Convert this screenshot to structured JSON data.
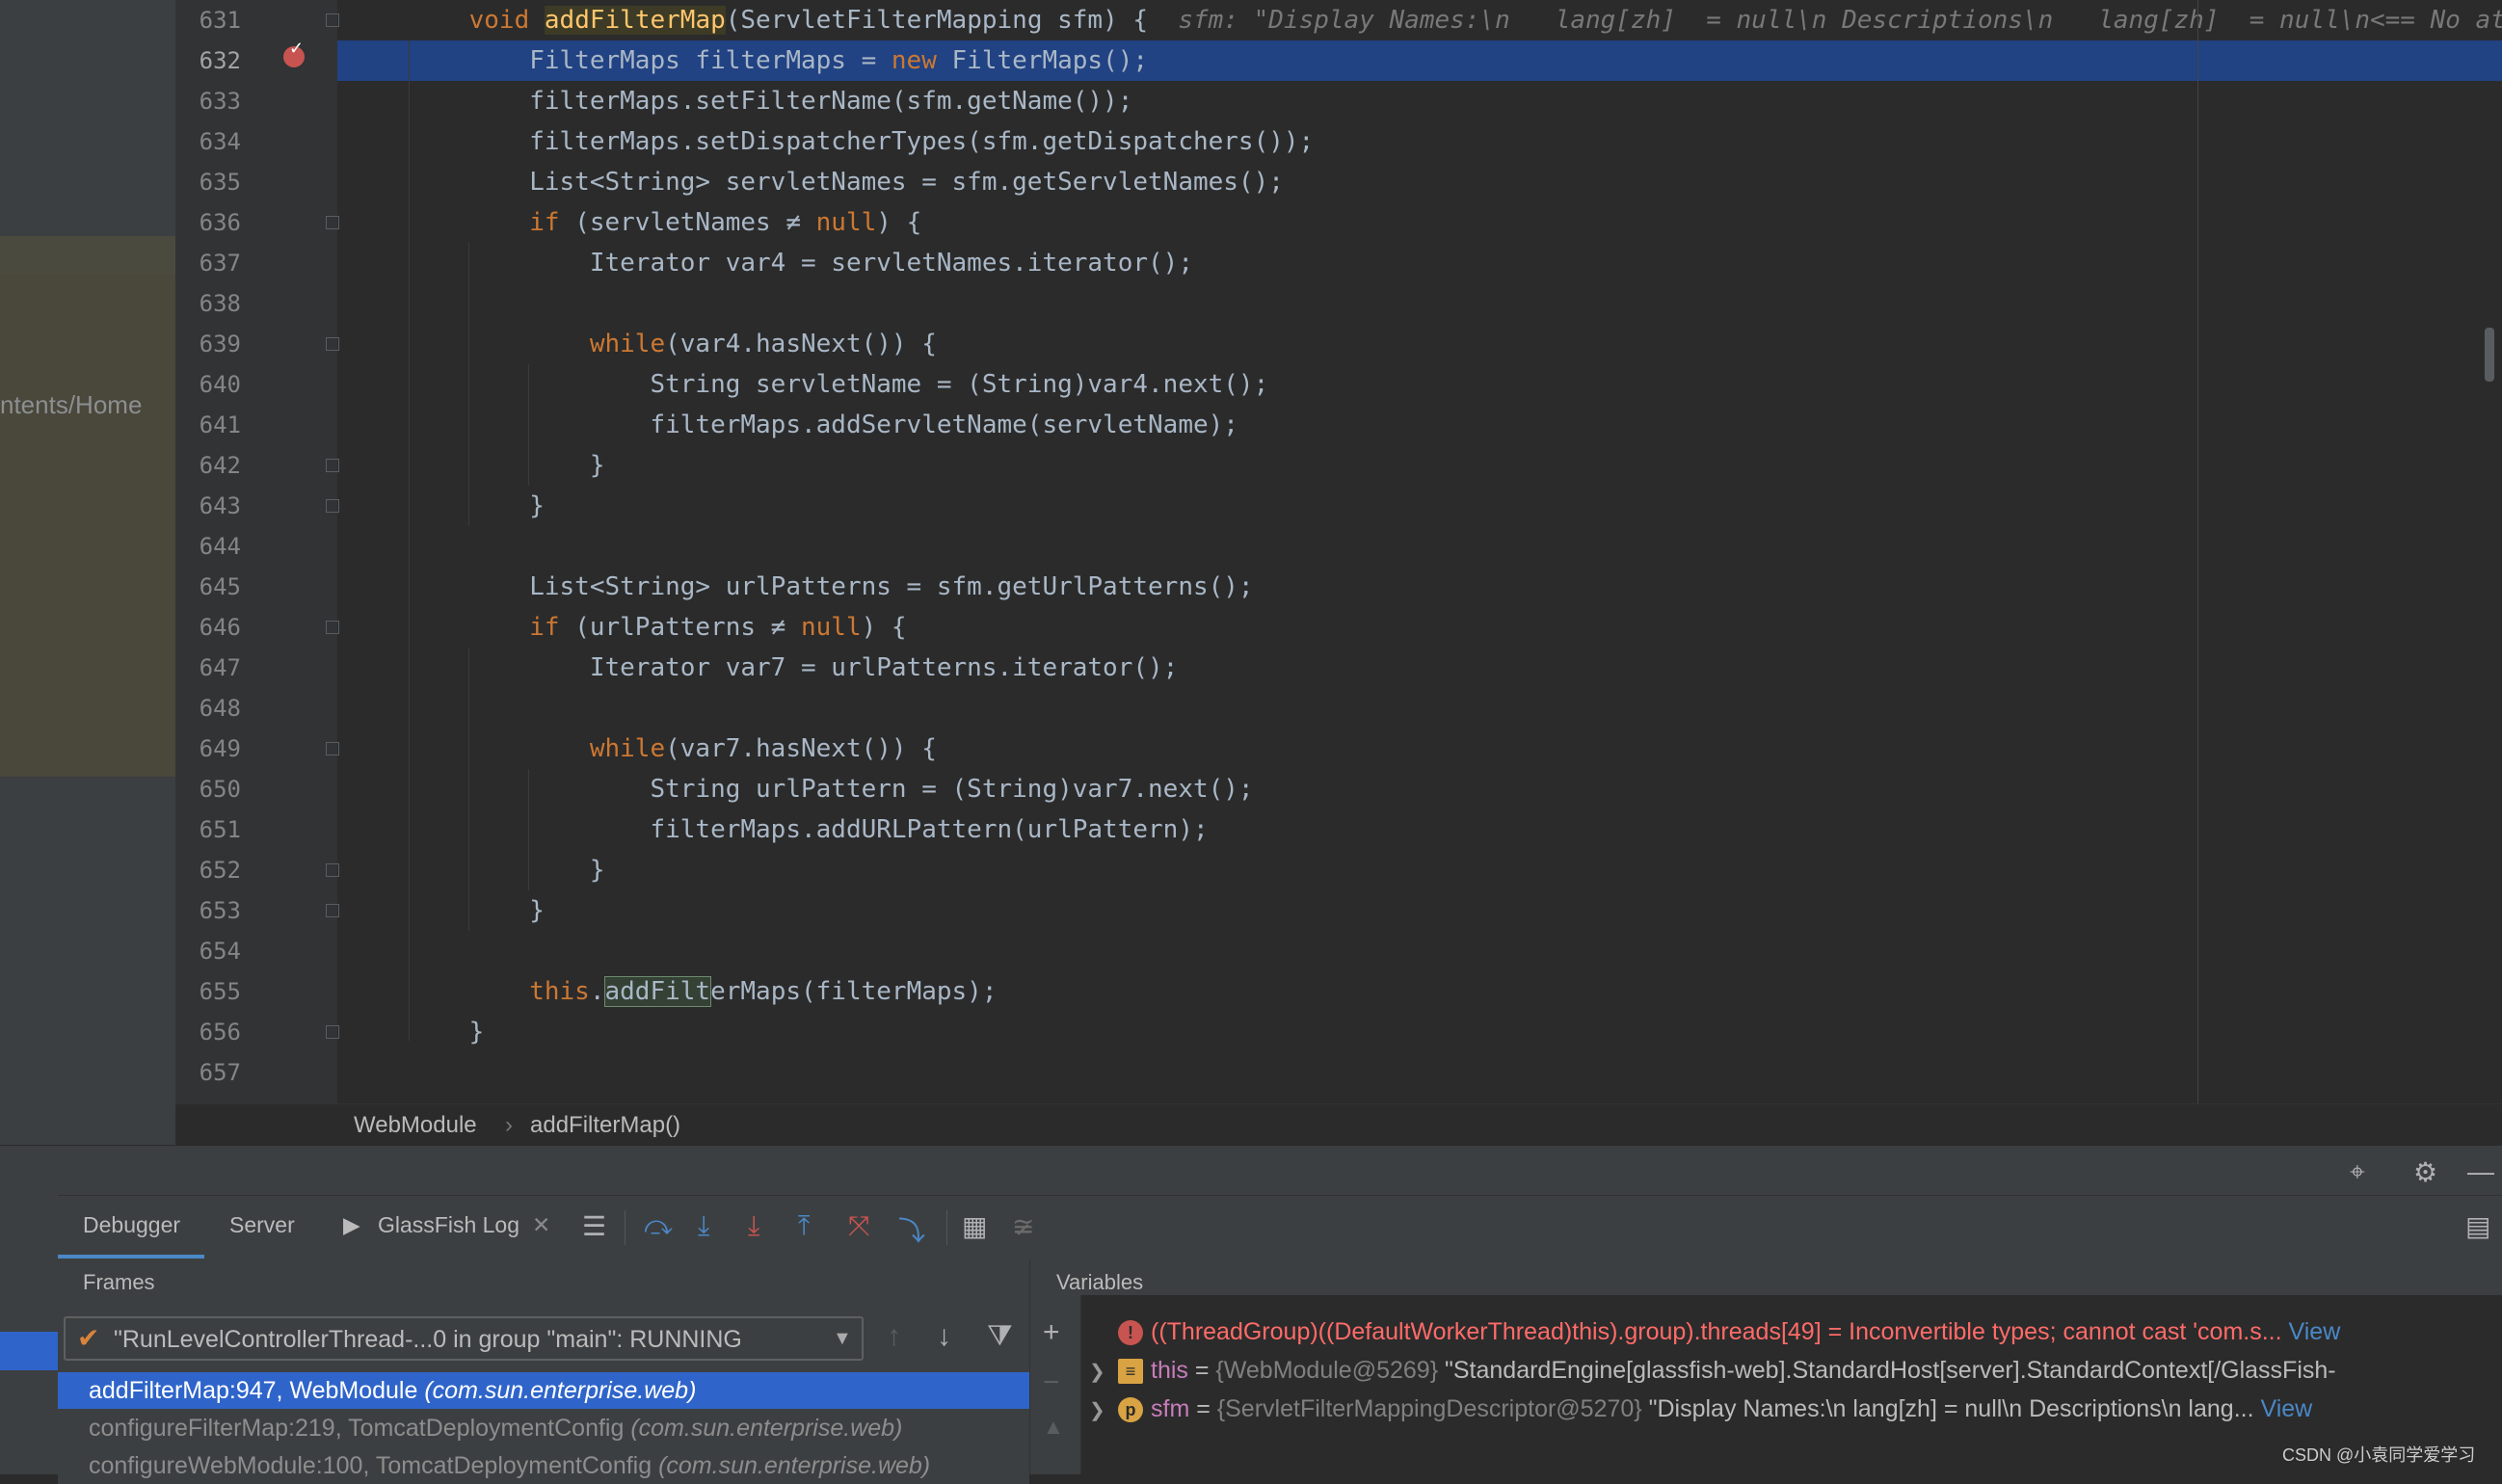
{
  "project_panel": {
    "path_fragment": "ntents/Home"
  },
  "editor": {
    "lines": [
      {
        "n": "631",
        "segs": [
          [
            "",
            "    "
          ],
          [
            "kw",
            "void "
          ],
          [
            "fnhl",
            "addFilterMap"
          ],
          [
            "",
            "(ServletFilterMapping sfm) {  "
          ],
          [
            "hint",
            "sfm: \"Display Names:\\n   lang[zh]  = null\\n Descriptions\\n   lang[zh]  = null\\n<== No at"
          ]
        ]
      },
      {
        "n": "632",
        "current": true,
        "segs": [
          [
            "",
            "        FilterMaps filterMaps = "
          ],
          [
            "kw",
            "new "
          ],
          [
            "",
            "FilterMaps();"
          ]
        ]
      },
      {
        "n": "633",
        "segs": [
          [
            "",
            "        filterMaps.setFilterName(sfm.getName());"
          ]
        ]
      },
      {
        "n": "634",
        "segs": [
          [
            "",
            "        filterMaps.setDispatcherTypes(sfm.getDispatchers());"
          ]
        ]
      },
      {
        "n": "635",
        "segs": [
          [
            "",
            "        List<String> servletNames = sfm.getServletNames();"
          ]
        ]
      },
      {
        "n": "636",
        "segs": [
          [
            "kw",
            "        if "
          ],
          [
            "",
            "(servletNames ≠ "
          ],
          [
            "kw",
            "null"
          ],
          [
            "",
            ") {"
          ]
        ]
      },
      {
        "n": "637",
        "segs": [
          [
            "",
            "            Iterator var4 = servletNames.iterator();"
          ]
        ]
      },
      {
        "n": "638",
        "segs": [
          [
            "",
            ""
          ]
        ]
      },
      {
        "n": "639",
        "segs": [
          [
            "kw",
            "            while"
          ],
          [
            "",
            "(var4.hasNext()) {"
          ]
        ]
      },
      {
        "n": "640",
        "segs": [
          [
            "",
            "                String servletName = (String)var4.next();"
          ]
        ]
      },
      {
        "n": "641",
        "segs": [
          [
            "",
            "                filterMaps.addServletName(servletName);"
          ]
        ]
      },
      {
        "n": "642",
        "segs": [
          [
            "",
            "            }"
          ]
        ]
      },
      {
        "n": "643",
        "segs": [
          [
            "",
            "        }"
          ]
        ]
      },
      {
        "n": "644",
        "segs": [
          [
            "",
            ""
          ]
        ]
      },
      {
        "n": "645",
        "segs": [
          [
            "",
            "        List<String> urlPatterns = sfm.getUrlPatterns();"
          ]
        ]
      },
      {
        "n": "646",
        "segs": [
          [
            "kw",
            "        if "
          ],
          [
            "",
            "(urlPatterns ≠ "
          ],
          [
            "kw",
            "null"
          ],
          [
            "",
            ") {"
          ]
        ]
      },
      {
        "n": "647",
        "segs": [
          [
            "",
            "            Iterator var7 = urlPatterns.iterator();"
          ]
        ]
      },
      {
        "n": "648",
        "segs": [
          [
            "",
            ""
          ]
        ]
      },
      {
        "n": "649",
        "segs": [
          [
            "kw",
            "            while"
          ],
          [
            "",
            "(var7.hasNext()) {"
          ]
        ]
      },
      {
        "n": "650",
        "segs": [
          [
            "",
            "                String urlPattern = (String)var7.next();"
          ]
        ]
      },
      {
        "n": "651",
        "segs": [
          [
            "",
            "                filterMaps.addURLPattern(urlPattern);"
          ]
        ]
      },
      {
        "n": "652",
        "segs": [
          [
            "",
            "            }"
          ]
        ]
      },
      {
        "n": "653",
        "segs": [
          [
            "",
            "        }"
          ]
        ]
      },
      {
        "n": "654",
        "segs": [
          [
            "",
            ""
          ]
        ]
      },
      {
        "n": "655",
        "segs": [
          [
            "kw",
            "        this"
          ],
          [
            "",
            "."
          ],
          [
            "match",
            "addFilt"
          ],
          [
            "",
            "erMaps(filterMaps);"
          ]
        ]
      },
      {
        "n": "656",
        "segs": [
          [
            "",
            "    }"
          ]
        ]
      },
      {
        "n": "657",
        "segs": [
          [
            "",
            ""
          ]
        ]
      }
    ]
  },
  "breadcrumb": {
    "class_name": "WebModule",
    "separator": "›",
    "method_name": "addFilterMap()"
  },
  "tool_window": {
    "tabs": {
      "debugger": "Debugger",
      "server": "Server",
      "glassfish_log": "GlassFish Log"
    }
  },
  "frames": {
    "title": "Frames",
    "thread": "\"RunLevelControllerThread-...0 in group \"main\": RUNNING",
    "items": [
      {
        "name": "addFilterMap:947, WebModule ",
        "pkg": "(com.sun.enterprise.web)"
      },
      {
        "name": "configureFilterMap:219, TomcatDeploymentConfig ",
        "pkg": "(com.sun.enterprise.web)"
      },
      {
        "name": "configureWebModule:100, TomcatDeploymentConfig ",
        "pkg": "(com.sun.enterprise.web)"
      }
    ]
  },
  "variables": {
    "title": "Variables",
    "error_row": {
      "expr": "((ThreadGroup)((DefaultWorkerThread)this).group).threads[49] = ",
      "msg": "Inconvertible types; cannot cast 'com.s...",
      "link": "View"
    },
    "this_row": {
      "name": "this",
      "eq": " = ",
      "id": "{WebModule@5269} ",
      "value": "\"StandardEngine[glassfish-web].StandardHost[server].StandardContext[/GlassFish-"
    },
    "sfm_row": {
      "name": "sfm",
      "eq": " = ",
      "id": "{ServletFilterMappingDescriptor@5270} ",
      "value": "\"Display Names:\\n   lang[zh]  = null\\n Descriptions\\n   lang...",
      "link": "View"
    }
  },
  "watermark": "CSDN @小袁同学爱学习",
  "colors": {
    "accent": "#2f65ca",
    "keyword": "#cc7832",
    "error": "#ff6b68",
    "current_line": "#214283"
  }
}
